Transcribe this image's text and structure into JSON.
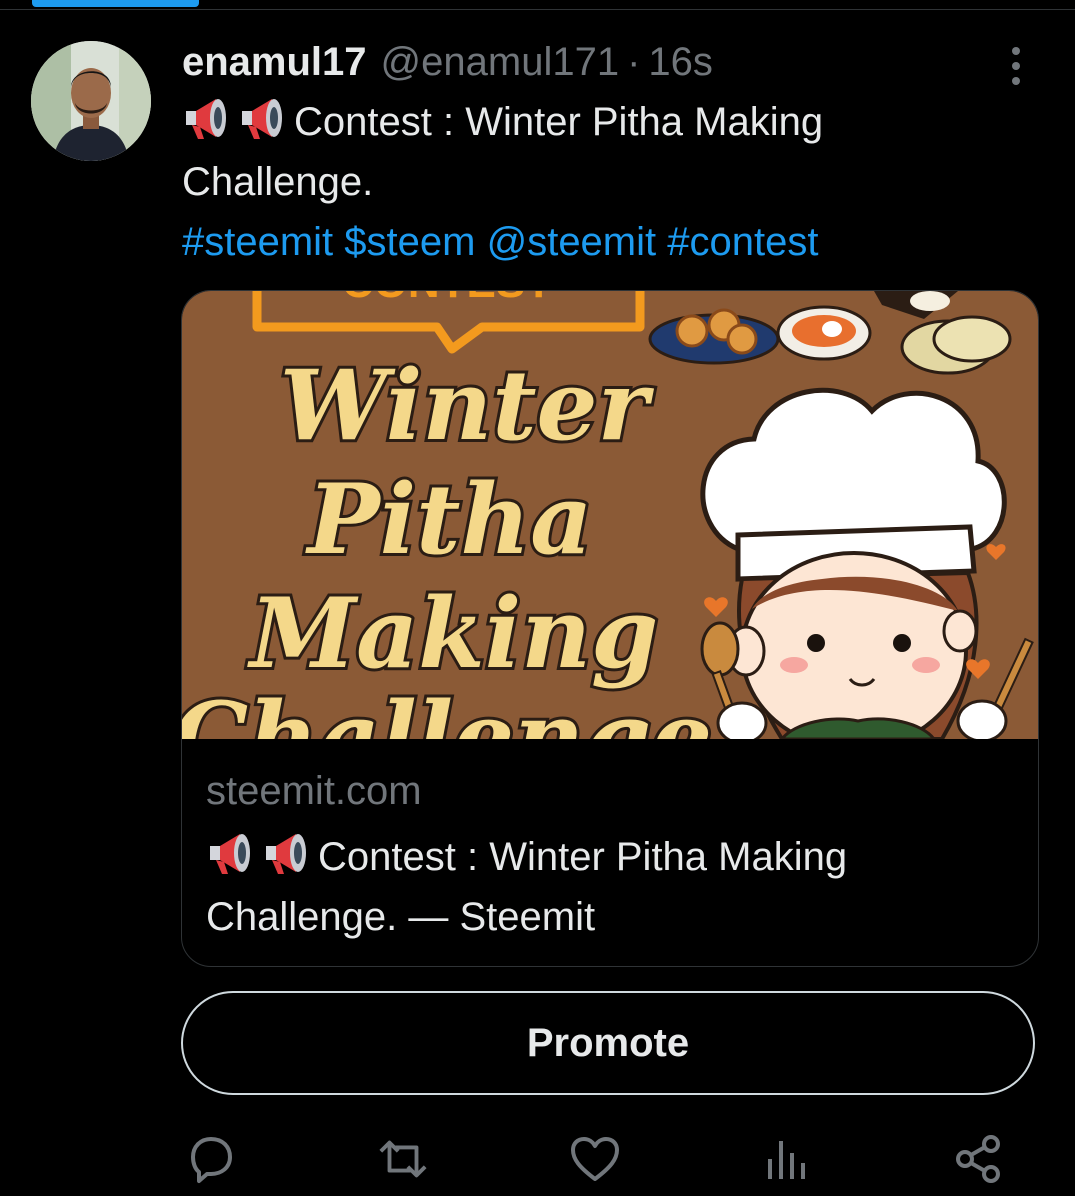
{
  "tweet": {
    "display_name": "enamul17",
    "handle": "@enamul171",
    "separator": "·",
    "time": "16s",
    "text_line1": "Contest : Winter Pitha Making",
    "text_line2": "Challenge.",
    "hashtags": [
      "#steemit",
      "$steem",
      "@steemit",
      "#contest"
    ]
  },
  "card": {
    "image_text": {
      "banner": "CONTEST",
      "line1": "Winter",
      "line2": "Pitha",
      "line3": "Making",
      "line4": "Challenge"
    },
    "domain": "steemit.com",
    "title_line1": "Contest : Winter Pitha Making",
    "title_line2": "Challenge. — Steemit"
  },
  "promote_label": "Promote",
  "icons": [
    "megaphone-icon",
    "more-icon",
    "reply-icon",
    "retweet-icon",
    "like-icon",
    "analytics-icon",
    "share-icon"
  ],
  "colors": {
    "background": "#000000",
    "link": "#1d9bf0",
    "secondary_text": "#71767b",
    "primary_text": "#e7e9ea",
    "card_bg": "#8b5a36"
  }
}
